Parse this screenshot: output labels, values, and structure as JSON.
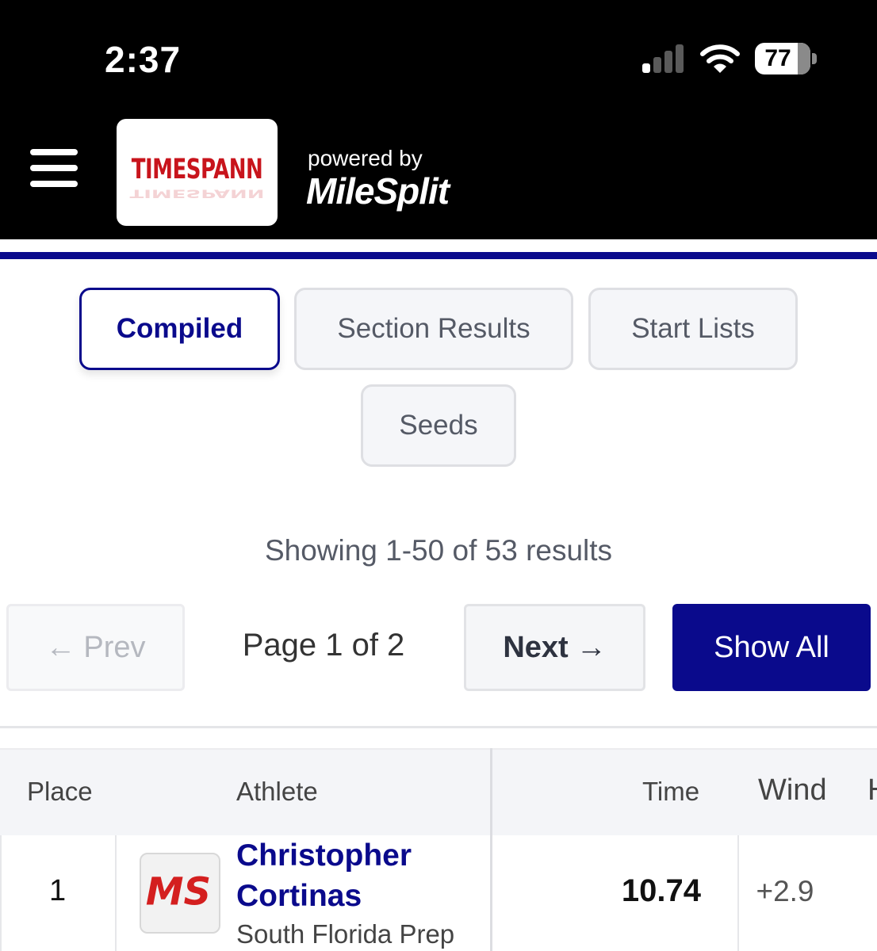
{
  "status_bar": {
    "time": "2:37",
    "battery_percent": "77",
    "battery_level": 0.77,
    "signal_bars_active": 1,
    "signal_bars_total": 4,
    "icons": [
      "cellular-signal-icon",
      "wifi-icon",
      "battery-icon"
    ]
  },
  "header": {
    "menu_icon": "hamburger-menu-icon",
    "brand_logo_text": "TIMESPANN",
    "powered_by_label": "powered by",
    "partner_logo_text": "MileSplit",
    "colors": {
      "brand_red": "#c8141c",
      "accent_blue": "#0a0a8c"
    }
  },
  "tabs": [
    {
      "label": "Compiled",
      "active": true
    },
    {
      "label": "Section Results",
      "active": false
    },
    {
      "label": "Start Lists",
      "active": false
    },
    {
      "label": "Seeds",
      "active": false
    }
  ],
  "results_summary": "Showing 1-50 of 53 results",
  "pagination": {
    "prev_label": "Prev",
    "page_label": "Page 1 of 2",
    "next_label": "Next",
    "show_all_label": "Show All",
    "arrow_left": "←",
    "arrow_right": "→"
  },
  "table": {
    "columns": [
      "Place",
      "Athlete",
      "Time",
      "Wind",
      "H"
    ],
    "rows": [
      {
        "place": "1",
        "avatar_text": "MS",
        "name": "Christopher Cortinas",
        "school": "South Florida Prep",
        "time": "10.74",
        "wind": "+2.9"
      }
    ]
  }
}
